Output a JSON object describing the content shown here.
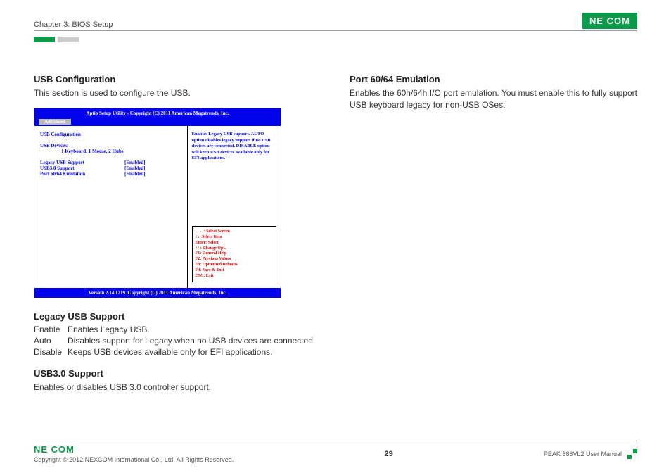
{
  "header": {
    "chapter": "Chapter 3: BIOS Setup",
    "logo_text": "NE COM"
  },
  "left": {
    "title": "USB Configuration",
    "intro": "This section is used to configure the USB.",
    "bios": {
      "header": "Aptio Setup Utility - Copyright (C) 2011 American Megatrends, Inc.",
      "menu_active": "Advanced",
      "section_title": "USB Configuration",
      "devices_label": "USB Devices:",
      "devices_value": "1 Keyboard, 1 Mouse, 2 Hubs",
      "opts": [
        {
          "label": "Legacy USB Support",
          "value": "[Enabled]"
        },
        {
          "label": "USB3.0 Support",
          "value": "[Enabled]"
        },
        {
          "label": "Port 60/64 Emulation",
          "value": "[Enabled]"
        }
      ],
      "help_text": "Enables Legacy USB support. AUTO option disables legacy support if no USB devices are connected. DISABLE option will keep USB devices available only for EFI applications.",
      "keys": [
        "→←: Select Screen",
        "↑↓: Select Item",
        "Enter: Select",
        "+/-: Change Opt.",
        "F1: General Help",
        "F2: Previous Values",
        "F3: Optimized Defaults",
        "F4: Save & Exit",
        "ESC: Exit"
      ],
      "footer": "Version 2.14.1219. Copyright (C) 2011 American Megatrends, Inc."
    },
    "legacy_title": "Legacy USB Support",
    "legacy_rows": [
      {
        "k": "Enable",
        "v": "Enables Legacy USB."
      },
      {
        "k": "Auto",
        "v": "Disables support for Legacy when no USB devices are connected."
      },
      {
        "k": "Disable",
        "v": "Keeps USB devices available only for EFI applications."
      }
    ],
    "usb30_title": "USB3.0 Support",
    "usb30_text": "Enables or disables USB 3.0 controller support."
  },
  "right": {
    "port_title": "Port 60/64 Emulation",
    "port_text": "Enables the 60h/64h I/O port emulation. You must enable this to fully support USB keyboard legacy for non-USB OSes."
  },
  "footer": {
    "logo_text": "NE COM",
    "copyright": "Copyright © 2012 NEXCOM International Co., Ltd. All Rights Reserved.",
    "page": "29",
    "manual": "PEAK 886VL2 User Manual"
  }
}
